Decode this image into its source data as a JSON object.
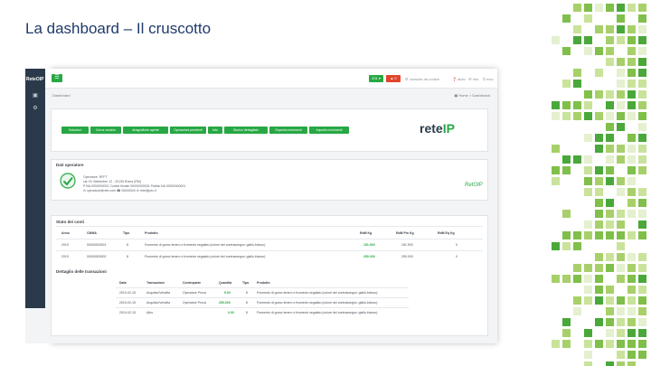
{
  "slide": {
    "title": "La dashboard – Il cruscotto"
  },
  "colors": {
    "accent": "#27a844",
    "danger": "#e2452b",
    "sidebar": "#2b3a4a",
    "title": "#1f3a6b"
  },
  "app": {
    "brand": "ReteOIP",
    "menu_icon": "hamburger-icon",
    "top": {
      "green_btn": "201 ▾",
      "red_btn": "▲ 0",
      "links": [
        "⚙ consulta da codice",
        "❓ aiuto",
        "☰ Info",
        "⏻ esci"
      ]
    },
    "breadcrumb_left": "Dashboard",
    "breadcrumb_right": "▣ Home > Dashboard"
  },
  "nav_buttons": [
    "Soluzioni",
    "Cerca vecchio",
    "Anagrafiche aperte",
    "Operazioni pendenti",
    "Info",
    "Storico dettagliato",
    "Esporta movimenti",
    "Importa movimenti"
  ],
  "logo": {
    "main": "rete",
    "accent": "IP"
  },
  "operator": {
    "title": "Dati operatore",
    "lines": [
      "Operatore: RFFT",
      "via XX Settembre 12 - 20135 Roma (RM)",
      "P.IVA 0000000001      Codice fiscale 00000000001      Partita IVA 00000000001",
      "✉ operatore@rete.com      ☎ 00000000      ✉ rete@pec.it"
    ],
    "signature": "RetOIP"
  },
  "table": {
    "title": "Stato dei conti",
    "headers": [
      "Anno",
      "CMMA",
      "Tipo",
      "Prodotto",
      "RdM Kg",
      "RdM Pm Kg",
      "RdM Eq Kg"
    ],
    "rows": [
      [
        "2019",
        "00000000001",
        "8",
        "Frumento di grano tenero e frumento segalato (colore del contrassegno: giallo-bianco)",
        "151.500",
        "151.500",
        "0"
      ],
      [
        "2019",
        "00000000002",
        "8",
        "Frumento di grano tenero e frumento segalato (colore del contrassegno: giallo-bianco)",
        "250.000",
        "250.000",
        "0"
      ]
    ]
  },
  "transactions": {
    "title": "Dettaglio delle transazioni",
    "headers": [
      "Data",
      "Transazione",
      "Controparte",
      "Quantità",
      "Tipo",
      "Prodotto"
    ],
    "rows": [
      [
        "2019-02-15",
        "Acquisto/Vendita",
        "Operatore Prova",
        "5.00",
        "8",
        "Frumento di grano tenero e frumento segalato (colore del contrassegno: giallo-bianco)"
      ],
      [
        "2019-02-15",
        "Acquisto/Vendita",
        "Operatore Prova",
        "250.000",
        "8",
        "Frumento di grano tenero e frumento segalato (colore del contrassegno: giallo-bianco)"
      ],
      [
        "2019-02-15",
        "Altro",
        "",
        "0.00",
        "8",
        "Frumento di grano tenero e frumento segalato (colore del contrassegno: giallo-bianco)"
      ]
    ]
  }
}
